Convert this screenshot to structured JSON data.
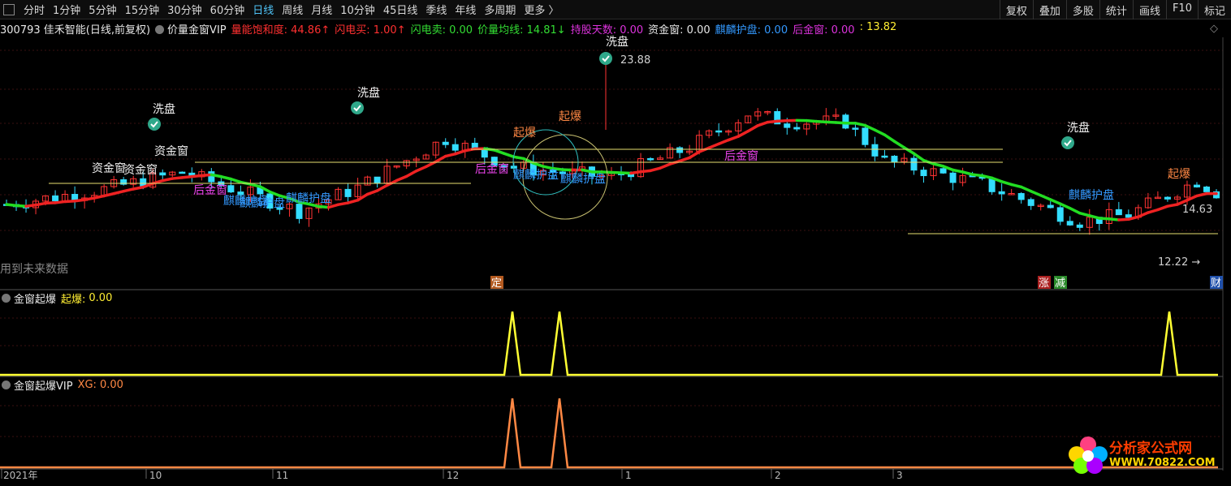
{
  "toolbar": {
    "periods": [
      "分时",
      "1分钟",
      "5分钟",
      "15分钟",
      "30分钟",
      "60分钟",
      "日线",
      "周线",
      "月线",
      "10分钟",
      "45日线",
      "季线",
      "年线",
      "多周期",
      "更多 〉"
    ],
    "active_period": "日线",
    "right_buttons": [
      "复权",
      "叠加",
      "多股",
      "统计",
      "画线",
      "F10",
      "标记"
    ]
  },
  "infobar": {
    "stock": "300793 佳禾智能(日线,前复权)",
    "indicator": "价量金窗VIP",
    "items": [
      {
        "text": "量能饱和度: 44.86↑",
        "color": "#ff3030"
      },
      {
        "text": "闪电买: 1.00↑",
        "color": "#ff3030"
      },
      {
        "text": "闪电卖: 0.00",
        "color": "#33dd33"
      },
      {
        "text": "价量均线: 14.81↓",
        "color": "#33dd33"
      },
      {
        "text": "持股天数: 0.00",
        "color": "#dd33dd"
      },
      {
        "text": "资金窗: 0.00",
        "color": "#e8e8e8"
      },
      {
        "text": "麒麟护盘: 0.00",
        "color": "#3399ff"
      },
      {
        "text": "后金窗: 0.00",
        "color": "#dd33dd"
      },
      {
        "text": ": 13.82",
        "color": "#ffee33"
      }
    ]
  },
  "main_chart": {
    "high_label": "23.88",
    "low_label": "12.22",
    "right_label": "14.63",
    "future_note": "用到未来数据",
    "annotations": {
      "xipan": "洗盘",
      "xipan_partial": "洗盘",
      "qibao": "起爆",
      "zijinchuang": "资金窗",
      "houjinchuang": "后金窗",
      "qilin": "麒麟护盘"
    },
    "markers": {
      "ding": "定",
      "zhang": "涨",
      "jian": "减",
      "cai": "财"
    }
  },
  "sub1": {
    "title": "金窗起爆",
    "label": "起爆:",
    "value": "0.00"
  },
  "sub2": {
    "title": "金窗起爆VIP",
    "label": "XG:",
    "value": "0.00"
  },
  "x_axis": {
    "labels": [
      "2021年",
      "10",
      "11",
      "12",
      "1",
      "2",
      "3"
    ]
  },
  "watermark": {
    "brand": "分析家公式网",
    "url": "WWW.70822.COM"
  },
  "colors": {
    "up": "#ff3333",
    "down": "#33ddff",
    "ma_up": "#ee2222",
    "ma_down": "#22dd22",
    "sub_line": "#ffff33",
    "sub2_line": "#ff8844"
  }
}
